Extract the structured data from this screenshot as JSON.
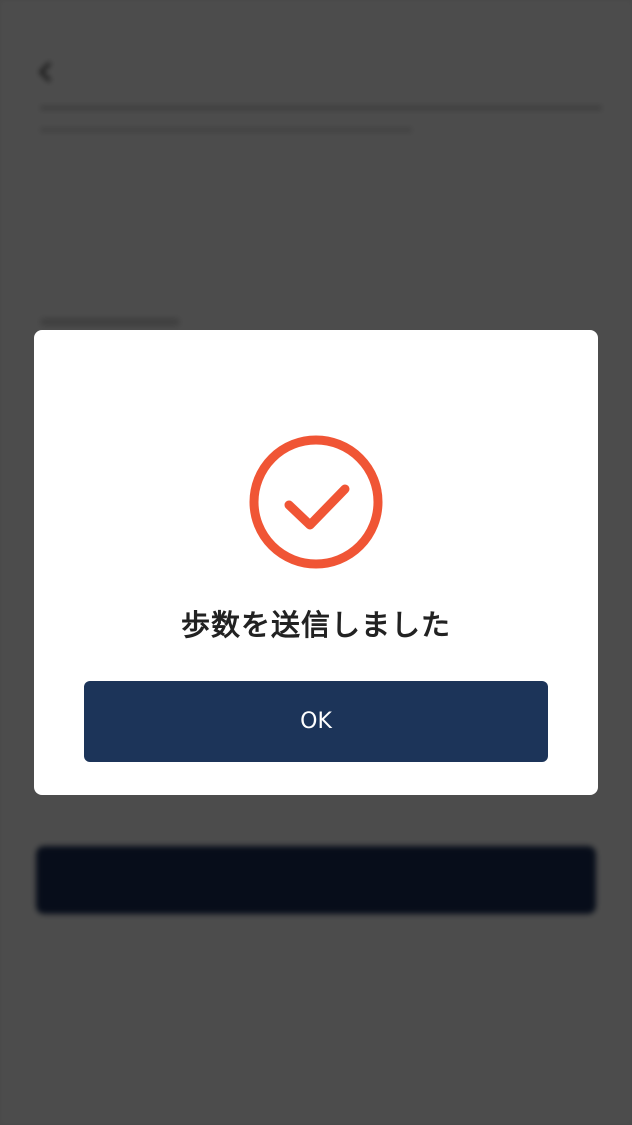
{
  "screen": {
    "header": {
      "title": "",
      "back_icon": "chevron-left-icon"
    },
    "section": {
      "title": ""
    },
    "primary_button": {
      "label": ""
    },
    "link": {
      "label": ""
    }
  },
  "dialog": {
    "status_icon": "check-circle-icon",
    "message": "歩数を送信しました",
    "ok_label": "OK"
  },
  "colors": {
    "accent": "#f05535",
    "primary": "#1c3459",
    "scrim": "rgba(0,0,0,0.70)"
  }
}
